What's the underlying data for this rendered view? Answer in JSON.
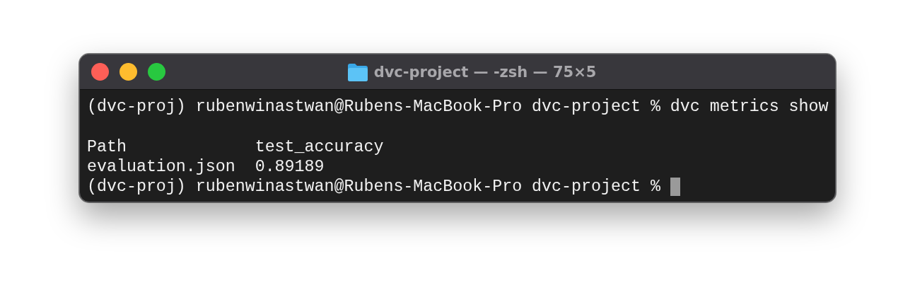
{
  "window": {
    "title": "dvc-project — -zsh — 75×5"
  },
  "terminal": [
    {
      "kind": "line",
      "text": "(dvc-proj) rubenwinastwan@Rubens-MacBook-Pro dvc-project % dvc metrics show",
      "cursor": false
    },
    {
      "kind": "blank"
    },
    {
      "kind": "table",
      "columns": [
        "Path",
        "test_accuracy"
      ],
      "rows": [
        [
          "evaluation.json",
          "0.89189"
        ]
      ]
    },
    {
      "kind": "line",
      "text": "(dvc-proj) rubenwinastwan@Rubens-MacBook-Pro dvc-project %",
      "cursor": true
    }
  ]
}
